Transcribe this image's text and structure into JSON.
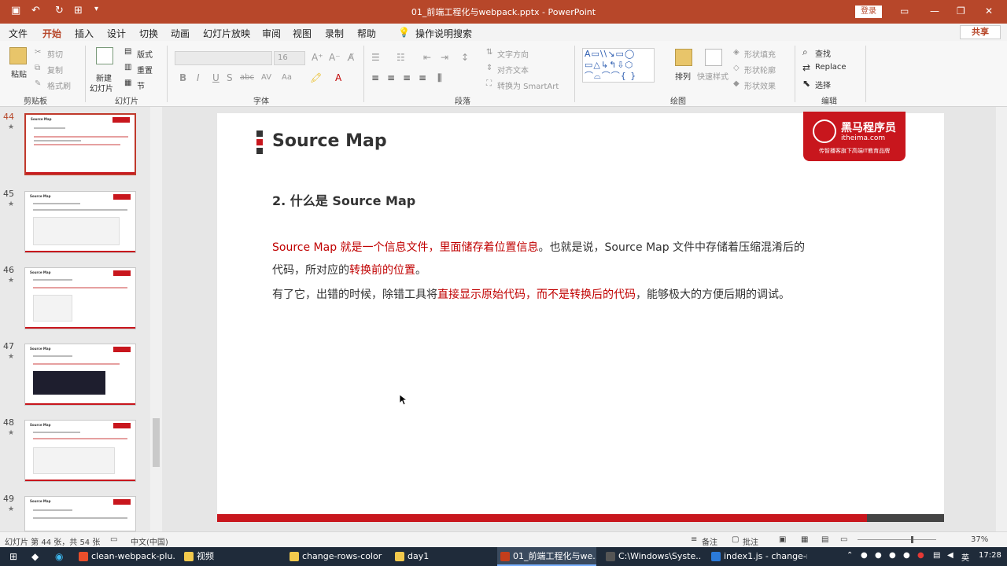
{
  "window": {
    "title": "01_前端工程化与webpack.pptx  -  PowerPoint",
    "login_label": "登录",
    "minimize_glyph": "—",
    "maximize_glyph": "❐",
    "close_glyph": "✕"
  },
  "menu": {
    "items": [
      "文件",
      "开始",
      "插入",
      "设计",
      "切换",
      "动画",
      "幻灯片放映",
      "审阅",
      "视图",
      "录制",
      "帮助"
    ],
    "active": "开始",
    "tell_me": "操作说明搜索",
    "share": "共享"
  },
  "ribbon": {
    "clipboard": {
      "label": "剪贴板",
      "paste": "粘贴",
      "cut": "剪切",
      "copy": "复制",
      "format_painter": "格式刷"
    },
    "slides": {
      "label": "幻灯片",
      "new_slide": "新建",
      "new_slide_2": "幻灯片",
      "layout": "版式",
      "reset": "重置",
      "section": "节"
    },
    "font": {
      "label": "字体",
      "size": "16",
      "bold": "B",
      "italic": "I",
      "underline": "U",
      "shadow": "S",
      "strike": "abc",
      "spacing": "AV",
      "case": "Aa"
    },
    "paragraph": {
      "label": "段落",
      "text_direction": "文字方向",
      "align_text": "对齐文本",
      "smartart": "转换为 SmartArt"
    },
    "drawing": {
      "label": "绘图",
      "arrange": "排列",
      "quick_styles": "快速样式",
      "shape_fill": "形状填充",
      "shape_outline": "形状轮廓",
      "shape_effects": "形状效果",
      "shapes_row1": "A▭\\\\↘▭◯",
      "shapes_row2": "▭△↳↰⇩⬡",
      "shapes_row3": "⌒⌓⌒⌒{ }"
    },
    "editing": {
      "label": "编辑",
      "find": "查找",
      "replace": "Replace",
      "select": "选择"
    }
  },
  "thumbnails": [
    {
      "num": "44",
      "title": "Source Map",
      "active": true
    },
    {
      "num": "45",
      "title": "Source Map",
      "active": false
    },
    {
      "num": "46",
      "title": "Source Map",
      "active": false
    },
    {
      "num": "47",
      "title": "Source Map",
      "active": false
    },
    {
      "num": "48",
      "title": "Source Map",
      "active": false
    },
    {
      "num": "49",
      "title": "Source Map",
      "active": false
    }
  ],
  "star": "★",
  "slide": {
    "title": "Source Map",
    "logo_name": "黑马程序员",
    "logo_url": "itheima.com",
    "logo_slogan": "传智播客旗下高端IT教育品牌",
    "heading": "2. 什么是 Source Map",
    "p1_a": "Source Map 就是一个信息文件，里面储存着位置信息",
    "p1_b": "。也就是说，Source Map 文件中存储着压缩混淆后的",
    "p2_a": "代码，所对应的",
    "p2_b": "转换前的位置",
    "p2_c": "。",
    "p3_a": "有了它，出错的时候，除错工具将",
    "p3_b": "直接显示原始代码，而不是转换后的代码",
    "p3_c": "，能够极大的方便后期的调试。"
  },
  "status": {
    "slide_info": "幻灯片 第 44 张，共 54 张",
    "language": "中文(中国)",
    "notes": "备注",
    "comments": "批注",
    "zoom": "37%"
  },
  "taskbar": {
    "tasks": [
      {
        "label": "clean-webpack-plu...",
        "color": "#e94e2b"
      },
      {
        "label": "视频",
        "color": "#f2c94c"
      },
      {
        "label": "change-rows-color",
        "color": "#f2c94c"
      },
      {
        "label": "day1",
        "color": "#f2c94c"
      },
      {
        "label": "01_前端工程化与we...",
        "color": "#c43e1c"
      },
      {
        "label": "C:\\Windows\\Syste...",
        "color": "#555555"
      },
      {
        "label": "index1.js - change-r...",
        "color": "#2b7ad9"
      }
    ],
    "lang": "英",
    "time": "17:28"
  }
}
